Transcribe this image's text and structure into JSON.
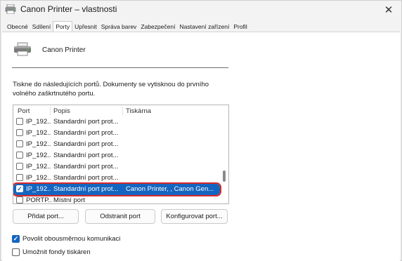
{
  "window": {
    "title": "Canon Printer – vlastnosti",
    "close_glyph": "✕"
  },
  "tabs": [
    {
      "label": "Obecné",
      "active": false
    },
    {
      "label": "Sdílení",
      "active": false
    },
    {
      "label": "Porty",
      "active": true
    },
    {
      "label": "Upřesnit",
      "active": false
    },
    {
      "label": "Správa barev",
      "active": false
    },
    {
      "label": "Zabezpečení",
      "active": false
    },
    {
      "label": "Nastavení zařízení",
      "active": false
    },
    {
      "label": "Profil",
      "active": false
    }
  ],
  "printer": {
    "name": "Canon Printer",
    "icon": "printer-icon"
  },
  "description": "Tiskne do následujících portů. Dokumenty se vytisknou do prvního volného zaškrtnutého portu.",
  "port_list": {
    "columns": [
      "Port",
      "Popis",
      "Tiskárna"
    ],
    "rows": [
      {
        "port": "IP_192...",
        "desc": "Standardní port prot...",
        "printer": "",
        "checked": false,
        "selected": false
      },
      {
        "port": "IP_192...",
        "desc": "Standardní port prot...",
        "printer": "",
        "checked": false,
        "selected": false
      },
      {
        "port": "IP_192...",
        "desc": "Standardní port prot...",
        "printer": "",
        "checked": false,
        "selected": false
      },
      {
        "port": "IP_192...",
        "desc": "Standardní port prot...",
        "printer": "",
        "checked": false,
        "selected": false
      },
      {
        "port": "IP_192...",
        "desc": "Standardní port prot...",
        "printer": "",
        "checked": false,
        "selected": false
      },
      {
        "port": "IP_192...",
        "desc": "Standardní port prot...",
        "printer": "",
        "checked": false,
        "selected": false
      },
      {
        "port": "IP_192...",
        "desc": "Standardní port prot...",
        "printer": "Canon Printer,     , Canon Gen...",
        "checked": true,
        "selected": true
      },
      {
        "port": "PORTP...",
        "desc": "Místní port",
        "printer": "",
        "checked": false,
        "selected": false
      }
    ]
  },
  "buttons": {
    "add_port": "Přidat port...",
    "delete_port": "Odstranit port",
    "configure_port": "Konfigurovat port..."
  },
  "options": {
    "bidirectional": {
      "label": "Povolit obousměrnou komunikaci",
      "checked": true
    },
    "pooling": {
      "label": "Umožnit fondy tiskáren",
      "checked": false
    }
  },
  "colors": {
    "accent": "#1565c0",
    "highlight_outline": "#d62a2a"
  }
}
